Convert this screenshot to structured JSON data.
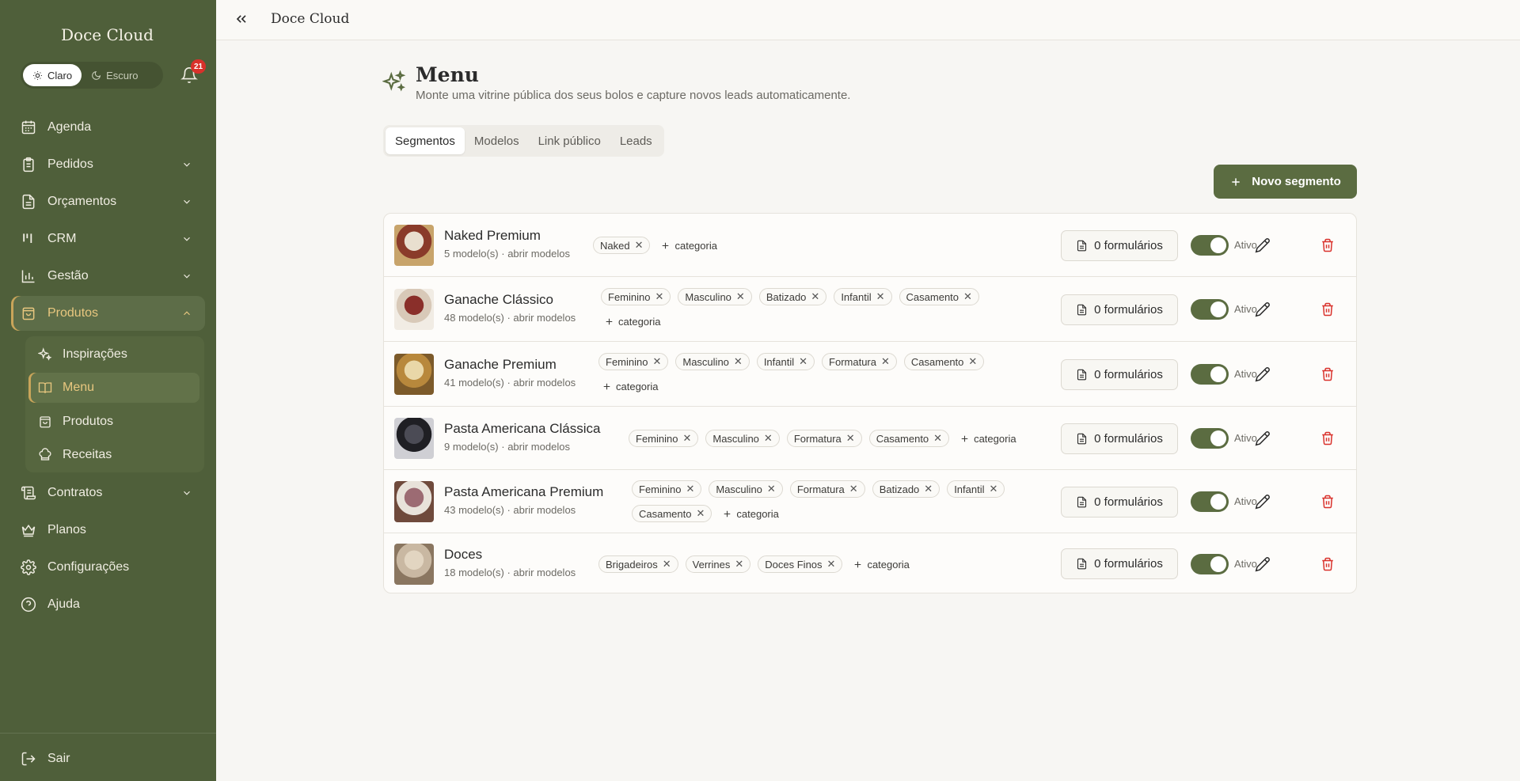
{
  "app": {
    "brand": "Doce Cloud",
    "top_title": "Doce Cloud"
  },
  "theme": {
    "light_label": "Claro",
    "dark_label": "Escuro"
  },
  "notifications": {
    "count": "21"
  },
  "nav": {
    "agenda": "Agenda",
    "pedidos": "Pedidos",
    "orcamentos": "Orçamentos",
    "crm": "CRM",
    "gestao": "Gestão",
    "produtos": "Produtos",
    "contratos": "Contratos",
    "planos": "Planos",
    "configuracoes": "Configurações",
    "ajuda": "Ajuda",
    "sair": "Sair"
  },
  "submenu": {
    "inspiracoes": "Inspirações",
    "menu": "Menu",
    "produtos": "Produtos",
    "receitas": "Receitas"
  },
  "page": {
    "title": "Menu",
    "subtitle": "Monte uma vitrine pública dos seus bolos e capture novos leads automaticamente."
  },
  "tabs": [
    {
      "label": "Segmentos",
      "active": true
    },
    {
      "label": "Modelos",
      "active": false
    },
    {
      "label": "Link público",
      "active": false
    },
    {
      "label": "Leads",
      "active": false
    }
  ],
  "new_segment_label": "Novo segmento",
  "segments": [
    {
      "name": "Naked Premium",
      "meta": "5 modelo(s) · abrir modelos",
      "tags": [
        "Naked"
      ],
      "add_label": "categoria",
      "forms": "0 formulários",
      "status": "Ativo",
      "active": true
    },
    {
      "name": "Ganache Clássico",
      "meta": "48 modelo(s) · abrir modelos",
      "tags": [
        "Feminino",
        "Masculino",
        "Batizado",
        "Infantil",
        "Casamento"
      ],
      "add_label": "categoria",
      "forms": "0 formulários",
      "status": "Ativo",
      "active": true
    },
    {
      "name": "Ganache Premium",
      "meta": "41 modelo(s) · abrir modelos",
      "tags": [
        "Feminino",
        "Masculino",
        "Infantil",
        "Formatura",
        "Casamento"
      ],
      "add_label": "categoria",
      "forms": "0 formulários",
      "status": "Ativo",
      "active": true
    },
    {
      "name": "Pasta Americana Clássica",
      "meta": "9 modelo(s) · abrir modelos",
      "tags": [
        "Feminino",
        "Masculino",
        "Formatura",
        "Casamento"
      ],
      "add_label": "categoria",
      "forms": "0 formulários",
      "status": "Ativo",
      "active": true
    },
    {
      "name": "Pasta Americana Premium",
      "meta": "43 modelo(s) · abrir modelos",
      "tags": [
        "Feminino",
        "Masculino",
        "Formatura",
        "Batizado",
        "Infantil",
        "Casamento"
      ],
      "add_label": "categoria",
      "forms": "0 formulários",
      "status": "Ativo",
      "active": true
    },
    {
      "name": "Doces",
      "meta": "18 modelo(s) · abrir modelos",
      "tags": [
        "Brigadeiros",
        "Verrines",
        "Doces Finos"
      ],
      "add_label": "categoria",
      "forms": "0 formulários",
      "status": "Ativo",
      "active": true
    }
  ],
  "colors": {
    "sidebar": "#4f5f3a",
    "accent": "#5b6c41",
    "gold": "#e8c77f",
    "danger": "#d9312b"
  }
}
